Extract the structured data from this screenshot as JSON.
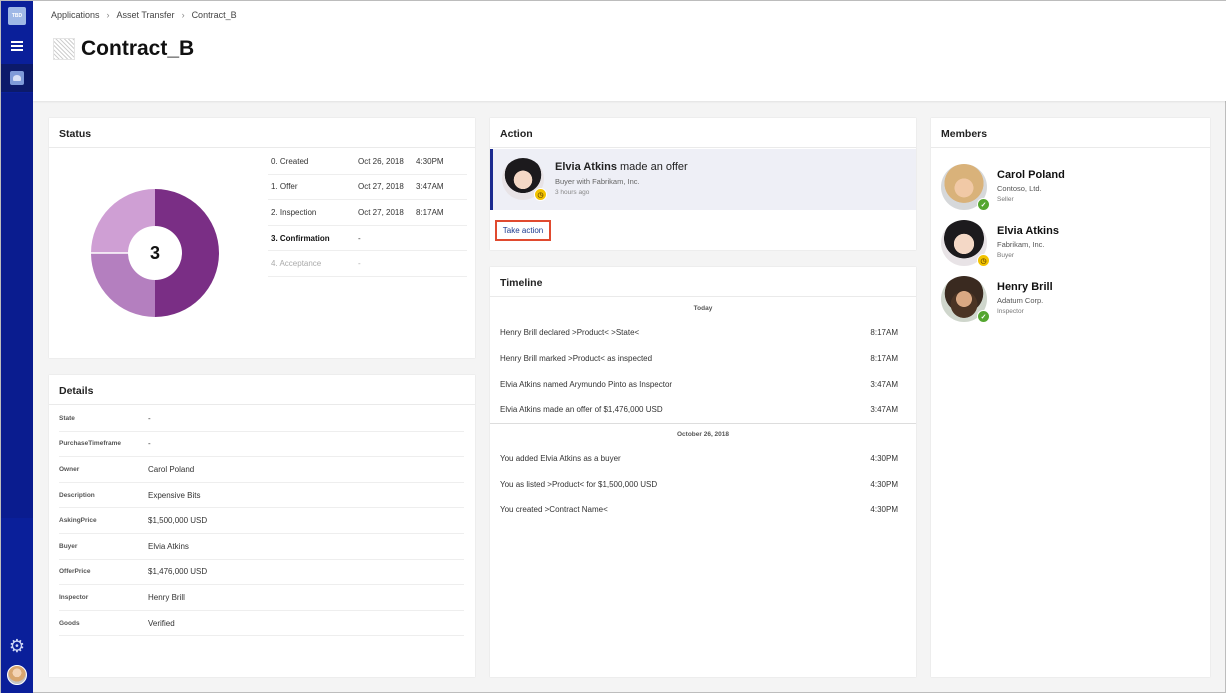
{
  "rail": {
    "logo_text": "TBD"
  },
  "breadcrumb": {
    "items": [
      "Applications",
      "Asset Transfer",
      "Contract_B"
    ]
  },
  "page": {
    "title": "Contract_B"
  },
  "status": {
    "title": "Status",
    "current_step": "3",
    "progress_fraction": 0.75,
    "colors": {
      "done": "#7a2e85",
      "partial": "#b47fbf",
      "pending": "#cf9fd4",
      "hole": "#ffffff"
    },
    "stages": [
      {
        "name": "0. Created",
        "date": "Oct 26, 2018",
        "time": "4:30PM",
        "state": "done"
      },
      {
        "name": "1. Offer",
        "date": "Oct 27, 2018",
        "time": "3:47AM",
        "state": "done"
      },
      {
        "name": "2. Inspection",
        "date": "Oct 27, 2018",
        "time": "8:17AM",
        "state": "done"
      },
      {
        "name": "3. Confirmation",
        "date": "-",
        "time": "",
        "state": "current"
      },
      {
        "name": "4. Acceptance",
        "date": "-",
        "time": "",
        "state": "future"
      }
    ]
  },
  "details": {
    "title": "Details",
    "rows": [
      {
        "key": "State",
        "value": "-"
      },
      {
        "key": "PurchaseTimeframe",
        "value": "-"
      },
      {
        "key": "Owner",
        "value": "Carol Poland"
      },
      {
        "key": "Description",
        "value": "Expensive Bits"
      },
      {
        "key": "AskingPrice",
        "value": "$1,500,000 USD"
      },
      {
        "key": "Buyer",
        "value": "Elvia Atkins"
      },
      {
        "key": "OfferPrice",
        "value": "$1,476,000 USD"
      },
      {
        "key": "Inspector",
        "value": "Henry Brill"
      },
      {
        "key": "Goods",
        "value": "Verified"
      }
    ]
  },
  "action": {
    "title": "Action",
    "actor": "Elvia Atkins",
    "verb": " made an offer",
    "subtitle": "Buyer with Fabrikam, Inc.",
    "ago": "3 hours ago",
    "button_label": "Take action"
  },
  "timeline": {
    "title": "Timeline",
    "groups": [
      {
        "label": "Today",
        "events": [
          {
            "text": "Henry Brill declared >Product< >State<",
            "time": "8:17AM"
          },
          {
            "text": "Henry Brill marked >Product< as inspected",
            "time": "8:17AM"
          },
          {
            "text": "Elvia Atkins named Arymundo Pinto as Inspector",
            "time": "3:47AM"
          },
          {
            "text": "Elvia Atkins made an offer of $1,476,000 USD",
            "time": "3:47AM"
          }
        ]
      },
      {
        "label": "October 26, 2018",
        "events": [
          {
            "text": "You added Elvia Atkins as a buyer",
            "time": "4:30PM"
          },
          {
            "text": "You as listed >Product< for $1,500,000 USD",
            "time": "4:30PM"
          },
          {
            "text": "You created >Contract Name<",
            "time": "4:30PM"
          }
        ]
      }
    ]
  },
  "members": {
    "title": "Members",
    "list": [
      {
        "name": "Carol Poland",
        "org": "Contoso, Ltd.",
        "role": "Seller",
        "status": "ok"
      },
      {
        "name": "Elvia Atkins",
        "org": "Fabrikam, Inc.",
        "role": "Buyer",
        "status": "wait"
      },
      {
        "name": "Henry Brill",
        "org": "Adatum Corp.",
        "role": "Inspector",
        "status": "ok"
      }
    ]
  }
}
